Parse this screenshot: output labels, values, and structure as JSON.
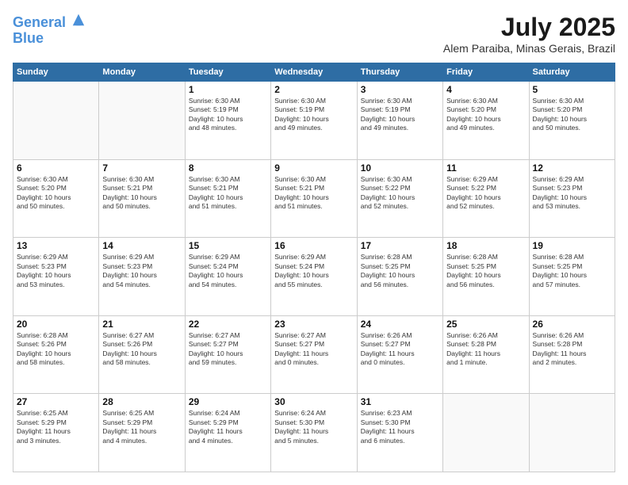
{
  "header": {
    "logo_line1": "General",
    "logo_line2": "Blue",
    "month_year": "July 2025",
    "location": "Alem Paraiba, Minas Gerais, Brazil"
  },
  "days_of_week": [
    "Sunday",
    "Monday",
    "Tuesday",
    "Wednesday",
    "Thursday",
    "Friday",
    "Saturday"
  ],
  "weeks": [
    [
      {
        "day": "",
        "content": ""
      },
      {
        "day": "",
        "content": ""
      },
      {
        "day": "1",
        "content": "Sunrise: 6:30 AM\nSunset: 5:19 PM\nDaylight: 10 hours\nand 48 minutes."
      },
      {
        "day": "2",
        "content": "Sunrise: 6:30 AM\nSunset: 5:19 PM\nDaylight: 10 hours\nand 49 minutes."
      },
      {
        "day": "3",
        "content": "Sunrise: 6:30 AM\nSunset: 5:19 PM\nDaylight: 10 hours\nand 49 minutes."
      },
      {
        "day": "4",
        "content": "Sunrise: 6:30 AM\nSunset: 5:20 PM\nDaylight: 10 hours\nand 49 minutes."
      },
      {
        "day": "5",
        "content": "Sunrise: 6:30 AM\nSunset: 5:20 PM\nDaylight: 10 hours\nand 50 minutes."
      }
    ],
    [
      {
        "day": "6",
        "content": "Sunrise: 6:30 AM\nSunset: 5:20 PM\nDaylight: 10 hours\nand 50 minutes."
      },
      {
        "day": "7",
        "content": "Sunrise: 6:30 AM\nSunset: 5:21 PM\nDaylight: 10 hours\nand 50 minutes."
      },
      {
        "day": "8",
        "content": "Sunrise: 6:30 AM\nSunset: 5:21 PM\nDaylight: 10 hours\nand 51 minutes."
      },
      {
        "day": "9",
        "content": "Sunrise: 6:30 AM\nSunset: 5:21 PM\nDaylight: 10 hours\nand 51 minutes."
      },
      {
        "day": "10",
        "content": "Sunrise: 6:30 AM\nSunset: 5:22 PM\nDaylight: 10 hours\nand 52 minutes."
      },
      {
        "day": "11",
        "content": "Sunrise: 6:29 AM\nSunset: 5:22 PM\nDaylight: 10 hours\nand 52 minutes."
      },
      {
        "day": "12",
        "content": "Sunrise: 6:29 AM\nSunset: 5:23 PM\nDaylight: 10 hours\nand 53 minutes."
      }
    ],
    [
      {
        "day": "13",
        "content": "Sunrise: 6:29 AM\nSunset: 5:23 PM\nDaylight: 10 hours\nand 53 minutes."
      },
      {
        "day": "14",
        "content": "Sunrise: 6:29 AM\nSunset: 5:23 PM\nDaylight: 10 hours\nand 54 minutes."
      },
      {
        "day": "15",
        "content": "Sunrise: 6:29 AM\nSunset: 5:24 PM\nDaylight: 10 hours\nand 54 minutes."
      },
      {
        "day": "16",
        "content": "Sunrise: 6:29 AM\nSunset: 5:24 PM\nDaylight: 10 hours\nand 55 minutes."
      },
      {
        "day": "17",
        "content": "Sunrise: 6:28 AM\nSunset: 5:25 PM\nDaylight: 10 hours\nand 56 minutes."
      },
      {
        "day": "18",
        "content": "Sunrise: 6:28 AM\nSunset: 5:25 PM\nDaylight: 10 hours\nand 56 minutes."
      },
      {
        "day": "19",
        "content": "Sunrise: 6:28 AM\nSunset: 5:25 PM\nDaylight: 10 hours\nand 57 minutes."
      }
    ],
    [
      {
        "day": "20",
        "content": "Sunrise: 6:28 AM\nSunset: 5:26 PM\nDaylight: 10 hours\nand 58 minutes."
      },
      {
        "day": "21",
        "content": "Sunrise: 6:27 AM\nSunset: 5:26 PM\nDaylight: 10 hours\nand 58 minutes."
      },
      {
        "day": "22",
        "content": "Sunrise: 6:27 AM\nSunset: 5:27 PM\nDaylight: 10 hours\nand 59 minutes."
      },
      {
        "day": "23",
        "content": "Sunrise: 6:27 AM\nSunset: 5:27 PM\nDaylight: 11 hours\nand 0 minutes."
      },
      {
        "day": "24",
        "content": "Sunrise: 6:26 AM\nSunset: 5:27 PM\nDaylight: 11 hours\nand 0 minutes."
      },
      {
        "day": "25",
        "content": "Sunrise: 6:26 AM\nSunset: 5:28 PM\nDaylight: 11 hours\nand 1 minute."
      },
      {
        "day": "26",
        "content": "Sunrise: 6:26 AM\nSunset: 5:28 PM\nDaylight: 11 hours\nand 2 minutes."
      }
    ],
    [
      {
        "day": "27",
        "content": "Sunrise: 6:25 AM\nSunset: 5:29 PM\nDaylight: 11 hours\nand 3 minutes."
      },
      {
        "day": "28",
        "content": "Sunrise: 6:25 AM\nSunset: 5:29 PM\nDaylight: 11 hours\nand 4 minutes."
      },
      {
        "day": "29",
        "content": "Sunrise: 6:24 AM\nSunset: 5:29 PM\nDaylight: 11 hours\nand 4 minutes."
      },
      {
        "day": "30",
        "content": "Sunrise: 6:24 AM\nSunset: 5:30 PM\nDaylight: 11 hours\nand 5 minutes."
      },
      {
        "day": "31",
        "content": "Sunrise: 6:23 AM\nSunset: 5:30 PM\nDaylight: 11 hours\nand 6 minutes."
      },
      {
        "day": "",
        "content": ""
      },
      {
        "day": "",
        "content": ""
      }
    ]
  ]
}
